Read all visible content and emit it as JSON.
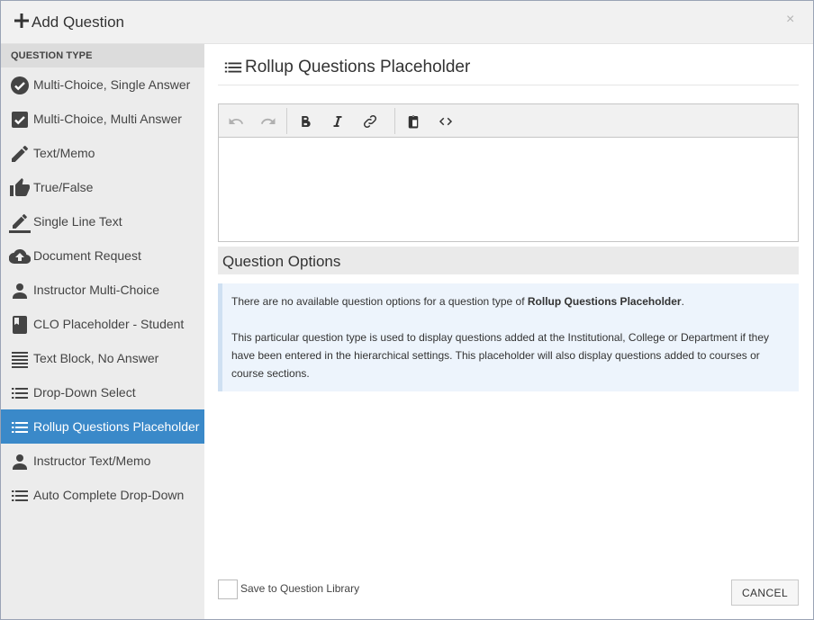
{
  "header": {
    "title": "Add Question",
    "close": "×"
  },
  "sidebar": {
    "section_label": "QUESTION TYPE",
    "items": [
      {
        "label": "Multi-Choice, Single Answer",
        "icon": "check-circle-icon"
      },
      {
        "label": "Multi-Choice, Multi Answer",
        "icon": "check-box-icon"
      },
      {
        "label": "Text/Memo",
        "icon": "pencil-icon"
      },
      {
        "label": "True/False",
        "icon": "thumbs-up-icon"
      },
      {
        "label": "Single Line Text",
        "icon": "edit-line-icon"
      },
      {
        "label": "Document Request",
        "icon": "cloud-upload-icon"
      },
      {
        "label": "Instructor Multi-Choice",
        "icon": "person-icon"
      },
      {
        "label": "CLO Placeholder - Student",
        "icon": "book-icon"
      },
      {
        "label": "Text Block, No Answer",
        "icon": "text-lines-icon"
      },
      {
        "label": "Drop-Down Select",
        "icon": "list-icon"
      },
      {
        "label": "Rollup Questions Placeholder",
        "icon": "list-icon",
        "active": true
      },
      {
        "label": "Instructor Text/Memo",
        "icon": "person-icon"
      },
      {
        "label": "Auto Complete Drop-Down",
        "icon": "list-icon"
      }
    ]
  },
  "main": {
    "question_title": "Rollup Questions Placeholder",
    "options_heading": "Question Options",
    "info": {
      "p1_prefix": "There are no available question options for a question type of ",
      "p1_bold": "Rollup Questions Placeholder",
      "p1_suffix": ".",
      "p2": "This particular question type is used to display questions added at the Institutional, College or Department if they have been entered in the hierarchical settings. This placeholder will also display questions added to courses or course sections."
    },
    "save_label": "Save to Question Library",
    "cancel_label": "CANCEL"
  },
  "colors": {
    "accent": "#3a89c9",
    "info_bg": "#edf4fc",
    "sidebar_bg": "#ececec"
  }
}
